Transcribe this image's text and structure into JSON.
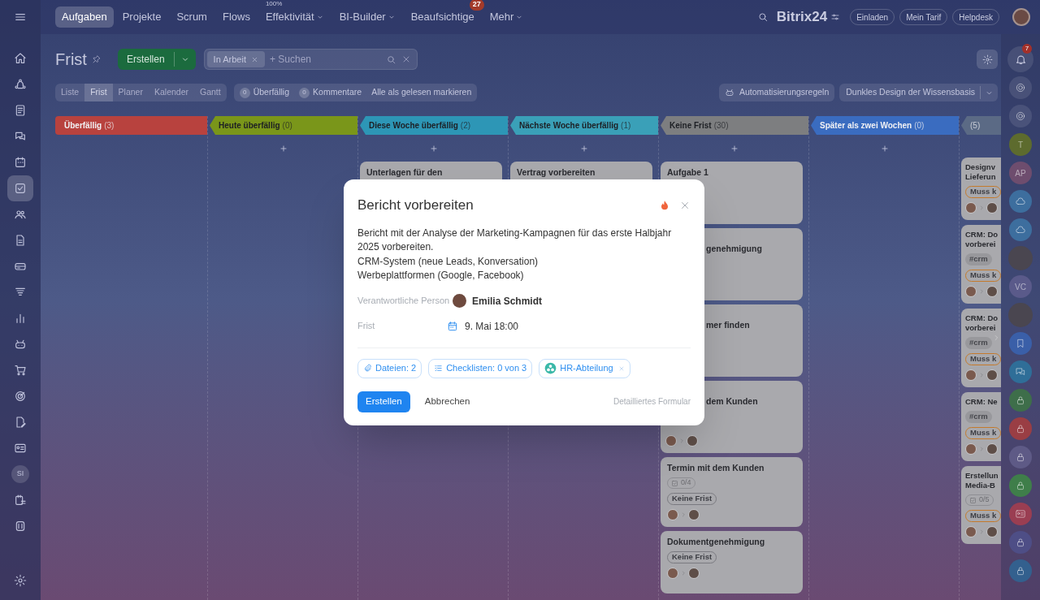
{
  "top_nav": {
    "tabs": [
      {
        "label": "Aufgaben",
        "selected": true,
        "dropdown": false
      },
      {
        "label": "Projekte",
        "selected": false,
        "dropdown": false
      },
      {
        "label": "Scrum",
        "selected": false,
        "dropdown": false
      },
      {
        "label": "Flows",
        "selected": false,
        "dropdown": false
      },
      {
        "label": "Effektivität",
        "selected": false,
        "dropdown": true,
        "superscript": "100%"
      },
      {
        "label": "BI-Builder",
        "selected": false,
        "dropdown": true
      },
      {
        "label": "Beaufsichtige",
        "selected": false,
        "dropdown": false,
        "badge": "27"
      },
      {
        "label": "Mehr",
        "selected": false,
        "dropdown": true
      }
    ],
    "logo": "Bitrix24",
    "buttons": [
      "Einladen",
      "Mein Tarif",
      "Helpdesk"
    ]
  },
  "left_sidebar": {
    "items": [
      {
        "kind": "home",
        "selected": false
      },
      {
        "kind": "flow",
        "selected": false
      },
      {
        "kind": "feed",
        "selected": false
      },
      {
        "kind": "chat",
        "selected": false
      },
      {
        "kind": "calendar",
        "selected": false
      },
      {
        "kind": "tasks",
        "selected": true
      },
      {
        "kind": "people",
        "selected": false
      },
      {
        "kind": "document",
        "selected": false
      },
      {
        "kind": "drive",
        "selected": false
      },
      {
        "kind": "funnel",
        "selected": false
      },
      {
        "kind": "chart",
        "selected": false
      },
      {
        "kind": "robot",
        "selected": false
      },
      {
        "kind": "cart",
        "selected": false
      },
      {
        "kind": "target",
        "selected": false
      },
      {
        "kind": "doc-edit",
        "selected": false
      },
      {
        "kind": "card",
        "selected": false
      },
      {
        "kind": "initials",
        "label": "SI",
        "selected": false
      },
      {
        "kind": "calendar-list",
        "selected": false
      },
      {
        "kind": "partner",
        "selected": false
      }
    ]
  },
  "header": {
    "title": "Frist",
    "create_button": "Erstellen",
    "filter_chips": [
      "In Arbeit"
    ],
    "placeholder": "+ Suchen"
  },
  "view_tabs": [
    {
      "label": "Liste",
      "selected": false
    },
    {
      "label": "Frist",
      "selected": true
    },
    {
      "label": "Planer",
      "selected": false
    },
    {
      "label": "Kalender",
      "selected": false
    },
    {
      "label": "Gantt",
      "selected": false
    }
  ],
  "counters": [
    {
      "count": "0",
      "label": "Überfällig"
    },
    {
      "count": "0",
      "label": "Kommentare"
    }
  ],
  "mark_all_read": "Alle als gelesen markieren",
  "automation_button": "Automatisierungsregeln",
  "theme_dropdown": "Dunkles Design der Wissensbasis",
  "columns": [
    {
      "title": "Überfällig",
      "count": "(3)",
      "color": "#b8423e",
      "can_add": false
    },
    {
      "title": "Heute überfällig",
      "count": "(0)",
      "color": "#7a961a",
      "can_add": true
    },
    {
      "title": "Diese Woche überfällig",
      "count": "(2)",
      "color": "#2d96b6",
      "can_add": true,
      "cards": [
        {
          "kind": "cut",
          "title": "Unterlagen für den"
        }
      ]
    },
    {
      "title": "Nächste Woche überfällig",
      "count": "(1)",
      "color": "#3aa0b8",
      "can_add": true,
      "cards": [
        {
          "kind": "cut",
          "title": "Vertrag vorbereiten"
        }
      ]
    },
    {
      "title": "Keine Frist",
      "count": "(30)",
      "color": "#7d7e80",
      "can_add": true,
      "cards": [
        {
          "kind": "plain",
          "title": "Aufgabe 1"
        },
        {
          "kind": "covered",
          "title": "genehmigung"
        },
        {
          "kind": "covered",
          "title": "mer finden"
        },
        {
          "kind": "covered",
          "title": "dem Kunden",
          "people": true
        },
        {
          "kind": "plain",
          "title": "Termin mit dem Kunden",
          "checklist": "0/4",
          "deadline": {
            "text": "Keine Frist",
            "kind": "plain"
          },
          "people": true
        },
        {
          "kind": "plain",
          "title": "Dokumentgenehmigung",
          "deadline": {
            "text": "Keine Frist",
            "kind": "plain"
          },
          "people": true
        }
      ]
    },
    {
      "title": "Später als zwei Wochen",
      "count": "(0)",
      "color": "#3a6cc0",
      "can_add": true
    },
    {
      "count": "(5)",
      "color": "#5b6a85",
      "can_add": false,
      "cards": [
        {
          "kind": "narrow",
          "title": "Designv\nLieferun",
          "deadline": {
            "text": "Muss k",
            "kind": "warning"
          },
          "people": true
        },
        {
          "kind": "narrow",
          "title": "CRM: Do\nvorberei",
          "tags": [
            "#crm"
          ],
          "deadline": {
            "text": "Muss k",
            "kind": "warning"
          },
          "people": true
        },
        {
          "kind": "narrow",
          "title": "CRM: Do\nvorberei",
          "tags": [
            "#crm"
          ],
          "deadline": {
            "text": "Muss k",
            "kind": "warning"
          },
          "people": true
        },
        {
          "kind": "narrow",
          "title": "CRM: Ne",
          "tags": [
            "#crm"
          ],
          "deadline": {
            "text": "Muss k",
            "kind": "warning"
          },
          "people": true
        },
        {
          "kind": "narrow",
          "title": "Erstellun\nMedia-B",
          "checklist": "0/5",
          "deadline": {
            "text": "Muss k",
            "kind": "warning"
          },
          "people": true
        }
      ]
    }
  ],
  "right_sidebar": {
    "items": [
      {
        "kind": "bell",
        "badge": "7"
      },
      {
        "kind": "swirl"
      },
      {
        "kind": "swirl"
      },
      {
        "kind": "initials",
        "label": "T",
        "color": "#5d6b2e"
      },
      {
        "kind": "initials",
        "label": "AP",
        "color": "#6e4d6e"
      },
      {
        "kind": "cloud",
        "color": "#3d6e9e"
      },
      {
        "kind": "cloud",
        "color": "#3d6e9e"
      },
      {
        "kind": "photo"
      },
      {
        "kind": "initials",
        "label": "VC",
        "color": "#5a5a8a"
      },
      {
        "kind": "photo"
      },
      {
        "kind": "bookmark",
        "color": "#3a5fa8"
      },
      {
        "kind": "chat",
        "color": "#2f6e98"
      },
      {
        "kind": "lock",
        "color": "#3e6e4a"
      },
      {
        "kind": "lock",
        "color": "#9a3e44"
      },
      {
        "kind": "lock",
        "color": "#5e5a86"
      },
      {
        "kind": "lock",
        "color": "#3f7e4a"
      },
      {
        "kind": "card",
        "color": "#9a3e52"
      },
      {
        "kind": "lock",
        "color": "#4e4e86"
      },
      {
        "kind": "lock",
        "color": "#33608e"
      }
    ]
  },
  "modal": {
    "title": "Bericht vorbereiten",
    "description": "Bericht mit der Analyse der Marketing-Kampagnen für das erste Halbjahr 2025 vorbereiten.\nCRM-System (neue Leads, Konversation)\nWerbeplattformen (Google, Facebook)",
    "fields": [
      {
        "kind": "person",
        "label": "Verantwortliche Person",
        "value": "Emilia Schmidt"
      },
      {
        "kind": "date",
        "label": "Frist",
        "value": "9. Mai 18:00"
      }
    ],
    "chips": [
      {
        "kind": "files",
        "label": "Dateien: 2"
      },
      {
        "kind": "checklist",
        "label": "Checklisten: 0 von 3"
      },
      {
        "kind": "group",
        "label": "HR-Abteilung",
        "removable": true
      }
    ],
    "primary_button": "Erstellen",
    "cancel_button": "Abbrechen",
    "detail_link": "Detailliertes Formular"
  }
}
